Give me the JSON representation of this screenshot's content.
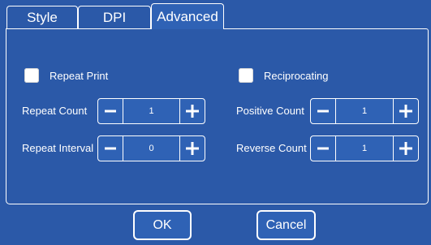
{
  "tabs": [
    {
      "label": "Style",
      "active": false
    },
    {
      "label": "DPI",
      "active": false
    },
    {
      "label": "Advanced",
      "active": true
    }
  ],
  "left": {
    "checkbox_label": "Repeat Print",
    "checked": false,
    "rows": [
      {
        "label": "Repeat Count",
        "value": "1"
      },
      {
        "label": "Repeat Interval",
        "value": "0"
      }
    ]
  },
  "right": {
    "checkbox_label": "Reciprocating",
    "checked": false,
    "rows": [
      {
        "label": "Positive Count",
        "value": "1"
      },
      {
        "label": "Reverse Count",
        "value": "1"
      }
    ]
  },
  "buttons": {
    "ok": "OK",
    "cancel": "Cancel"
  },
  "icons": {
    "decrement": "minus-icon",
    "increment": "plus-icon"
  },
  "colors": {
    "background": "#2b59a8",
    "border": "#ffffff",
    "text": "#ffffff"
  }
}
